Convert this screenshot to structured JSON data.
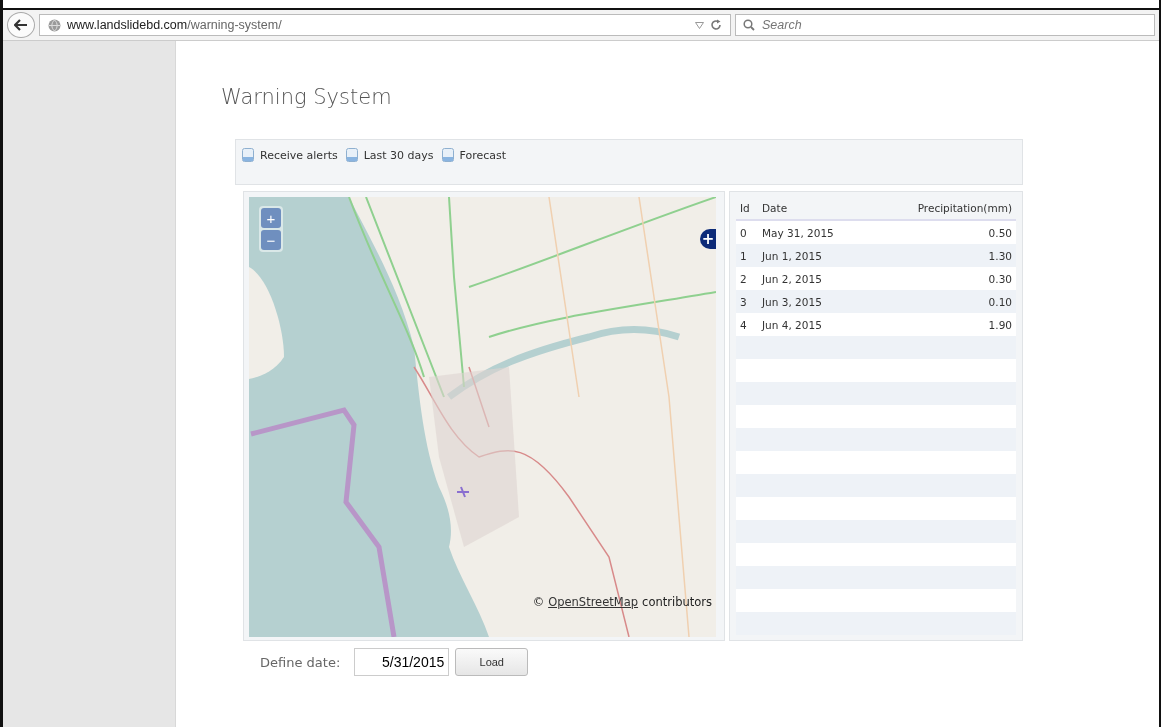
{
  "browser": {
    "url_domain": "www.landslidebd.com",
    "url_path": "/warning-system/",
    "search_placeholder": "Search"
  },
  "page": {
    "title": "Warning System"
  },
  "toolbar": {
    "links": [
      {
        "label": "Receive alerts"
      },
      {
        "label": "Last 30 days"
      },
      {
        "label": "Forecast"
      }
    ]
  },
  "map": {
    "zoom_in": "+",
    "zoom_out": "−",
    "layer_button": "+",
    "attribution_prefix": "©",
    "attribution_link": "OpenStreetMap",
    "attribution_suffix": "contributors"
  },
  "table": {
    "columns": [
      "Id",
      "Date",
      "Precipitation(mm)"
    ],
    "rows": [
      [
        "0",
        "May 31, 2015",
        "0.50"
      ],
      [
        "1",
        "Jun 1, 2015",
        "1.30"
      ],
      [
        "2",
        "Jun 2, 2015",
        "0.30"
      ],
      [
        "3",
        "Jun 3, 2015",
        "0.10"
      ],
      [
        "4",
        "Jun 4, 2015",
        "1.90"
      ]
    ]
  },
  "date_form": {
    "label": "Define date:",
    "value": "5/31/2015",
    "button": "Load"
  }
}
